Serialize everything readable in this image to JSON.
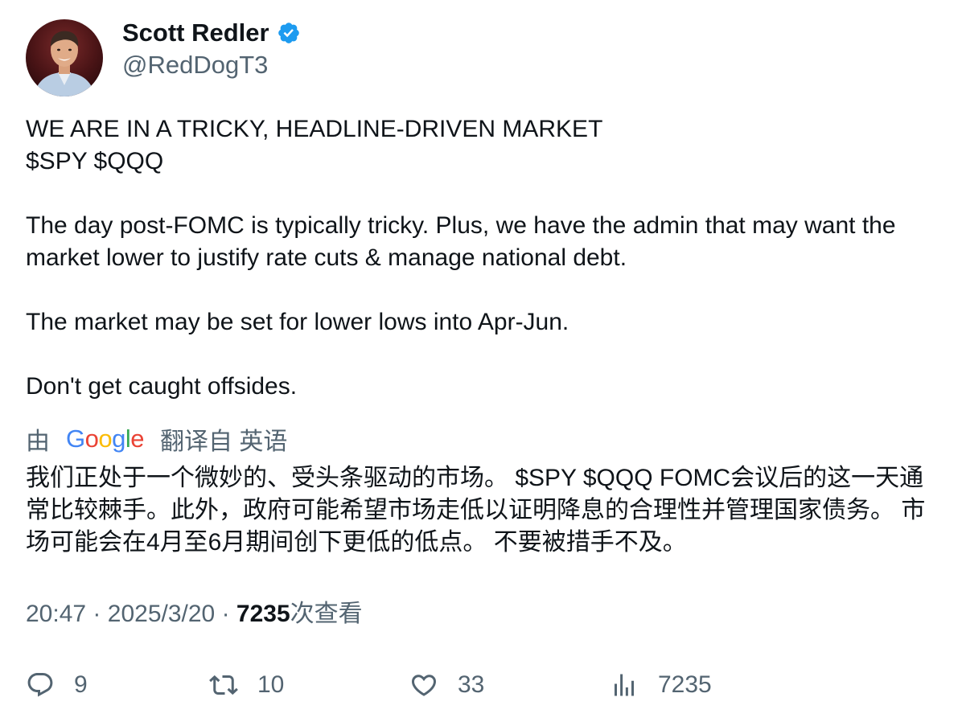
{
  "author": {
    "display_name": "Scott Redler",
    "handle": "@RedDogT3",
    "verified": true,
    "verified_color": "#1d9bf0"
  },
  "tweet": {
    "paragraphs": [
      "WE ARE IN A TRICKY, HEADLINE-DRIVEN MARKET\n$SPY $QQQ",
      "The day post-FOMC is typically tricky. Plus, we have the admin that may want the market lower to justify rate cuts & manage national debt.",
      "The market may be set for lower lows into Apr-Jun.",
      "Don't get caught offsides."
    ]
  },
  "translation": {
    "prefix": "由",
    "provider": "Google",
    "suffix": "翻译自 英语",
    "text": "我们正处于一个微妙的、受头条驱动的市场。 $SPY $QQQ FOMC会议后的这一天通常比较棘手。此外，政府可能希望市场走低以证明降息的合理性并管理国家债务。 市场可能会在4月至6月期间创下更低的低点。 不要被措手不及。"
  },
  "meta": {
    "time": "20:47",
    "separator": "·",
    "date": "2025/3/20",
    "views_count": "7235",
    "views_label": "次查看"
  },
  "actions": {
    "reply_count": "9",
    "retweet_count": "10",
    "like_count": "33",
    "views_count": "7235",
    "reply_icon": "reply-bubble-icon",
    "retweet_icon": "retweet-icon",
    "like_icon": "heart-icon",
    "views_icon": "analytics-bars-icon"
  },
  "colors": {
    "text_primary": "#0f1419",
    "text_secondary": "#536471",
    "google_blue": "#4285F4",
    "google_red": "#EA4335",
    "google_yellow": "#FBBC05",
    "google_green": "#34A853"
  }
}
